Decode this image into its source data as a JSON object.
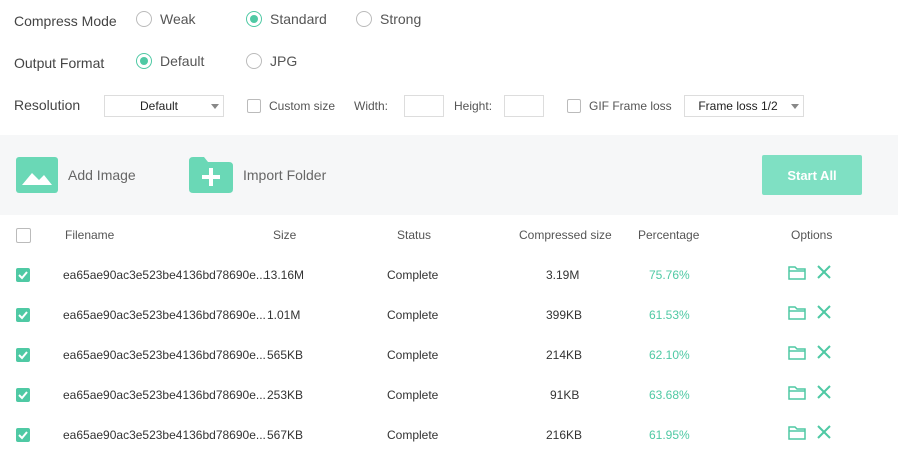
{
  "settings": {
    "compress_mode": {
      "label": "Compress Mode",
      "options": [
        "Weak",
        "Standard",
        "Strong"
      ],
      "selected": "Standard"
    },
    "output_format": {
      "label": "Output Format",
      "options": [
        "Default",
        "JPG"
      ],
      "selected": "Default"
    },
    "resolution": {
      "label": "Resolution",
      "select_value": "Default",
      "custom_size_label": "Custom size",
      "width_label": "Width:",
      "height_label": "Height:",
      "gif_label": "GIF Frame loss",
      "gif_select_value": "Frame loss 1/2"
    }
  },
  "toolbar": {
    "add_image": "Add Image",
    "import_folder": "Import Folder",
    "start_all": "Start All"
  },
  "table": {
    "headers": [
      "Filename",
      "Size",
      "Status",
      "Compressed size",
      "Percentage",
      "Options"
    ],
    "rows": [
      {
        "filename": "ea65ae90ac3e523be4136bd78690e...",
        "size": "13.16M",
        "status": "Complete",
        "compressed": "3.19M",
        "percentage": "75.76%"
      },
      {
        "filename": "ea65ae90ac3e523be4136bd78690e...",
        "size": "1.01M",
        "status": "Complete",
        "compressed": "399KB",
        "percentage": "61.53%"
      },
      {
        "filename": "ea65ae90ac3e523be4136bd78690e...",
        "size": "565KB",
        "status": "Complete",
        "compressed": "214KB",
        "percentage": "62.10%"
      },
      {
        "filename": "ea65ae90ac3e523be4136bd78690e...",
        "size": "253KB",
        "status": "Complete",
        "compressed": "91KB",
        "percentage": "63.68%"
      },
      {
        "filename": "ea65ae90ac3e523be4136bd78690e...",
        "size": "567KB",
        "status": "Complete",
        "compressed": "216KB",
        "percentage": "61.95%"
      }
    ]
  },
  "colors": {
    "accent": "#4fc9a4",
    "start_button": "#7fe0c3",
    "toolbar_bg": "#f6f7f8"
  }
}
